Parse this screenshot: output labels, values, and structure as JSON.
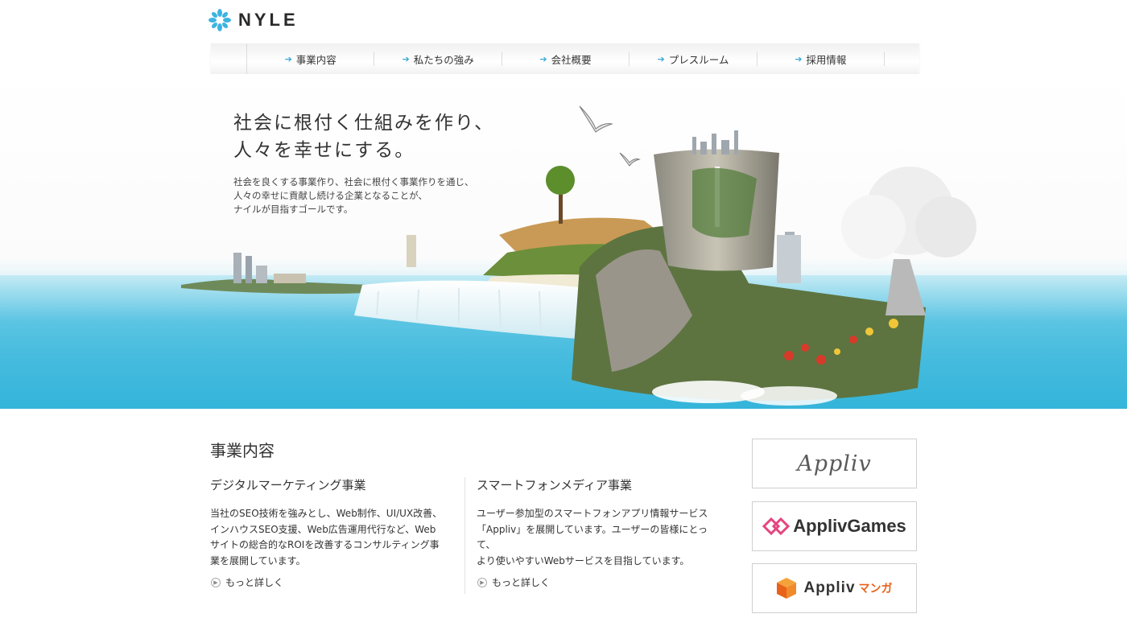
{
  "header": {
    "logo_text": "NYLE"
  },
  "nav": {
    "items": [
      {
        "label": "事業内容"
      },
      {
        "label": "私たちの強み"
      },
      {
        "label": "会社概要"
      },
      {
        "label": "プレスルーム"
      },
      {
        "label": "採用情報"
      }
    ]
  },
  "hero": {
    "title_line1": "社会に根付く仕組みを作り、",
    "title_line2": "人々を幸せにする。",
    "desc_line1": "社会を良くする事業作り、社会に根付く事業作りを通じ、",
    "desc_line2": "人々の幸せに貢献し続ける企業となることが、",
    "desc_line3": "ナイルが目指すゴールです。"
  },
  "business": {
    "title": "事業内容",
    "col1": {
      "heading": "デジタルマーケティング事業",
      "body_line1": "当社のSEO技術を強みとし、Web制作、UI/UX改善、",
      "body_line2": "インハウスSEO支援、Web広告運用代行など、Web",
      "body_line3": "サイトの総合的なROIを改善するコンサルティング事",
      "body_line4": "業を展開しています。",
      "more": "もっと詳しく"
    },
    "col2": {
      "heading": "スマートフォンメディア事業",
      "body_line1": "ユーザー参加型のスマートフォンアプリ情報サービス",
      "body_line2": "「Appliv」を展開しています。ユーザーの皆様にとって、",
      "body_line3": "より使いやすいWebサービスを目指しています。",
      "more": "もっと詳しく"
    }
  },
  "banners": {
    "appliv": "Appliv",
    "games": "ApplivGames",
    "manga_main": "Appliv",
    "manga_suffix": "マンガ"
  },
  "colors": {
    "accent": "#38a7d6",
    "games_pink": "#e4457f",
    "manga_orange": "#e8621a"
  }
}
